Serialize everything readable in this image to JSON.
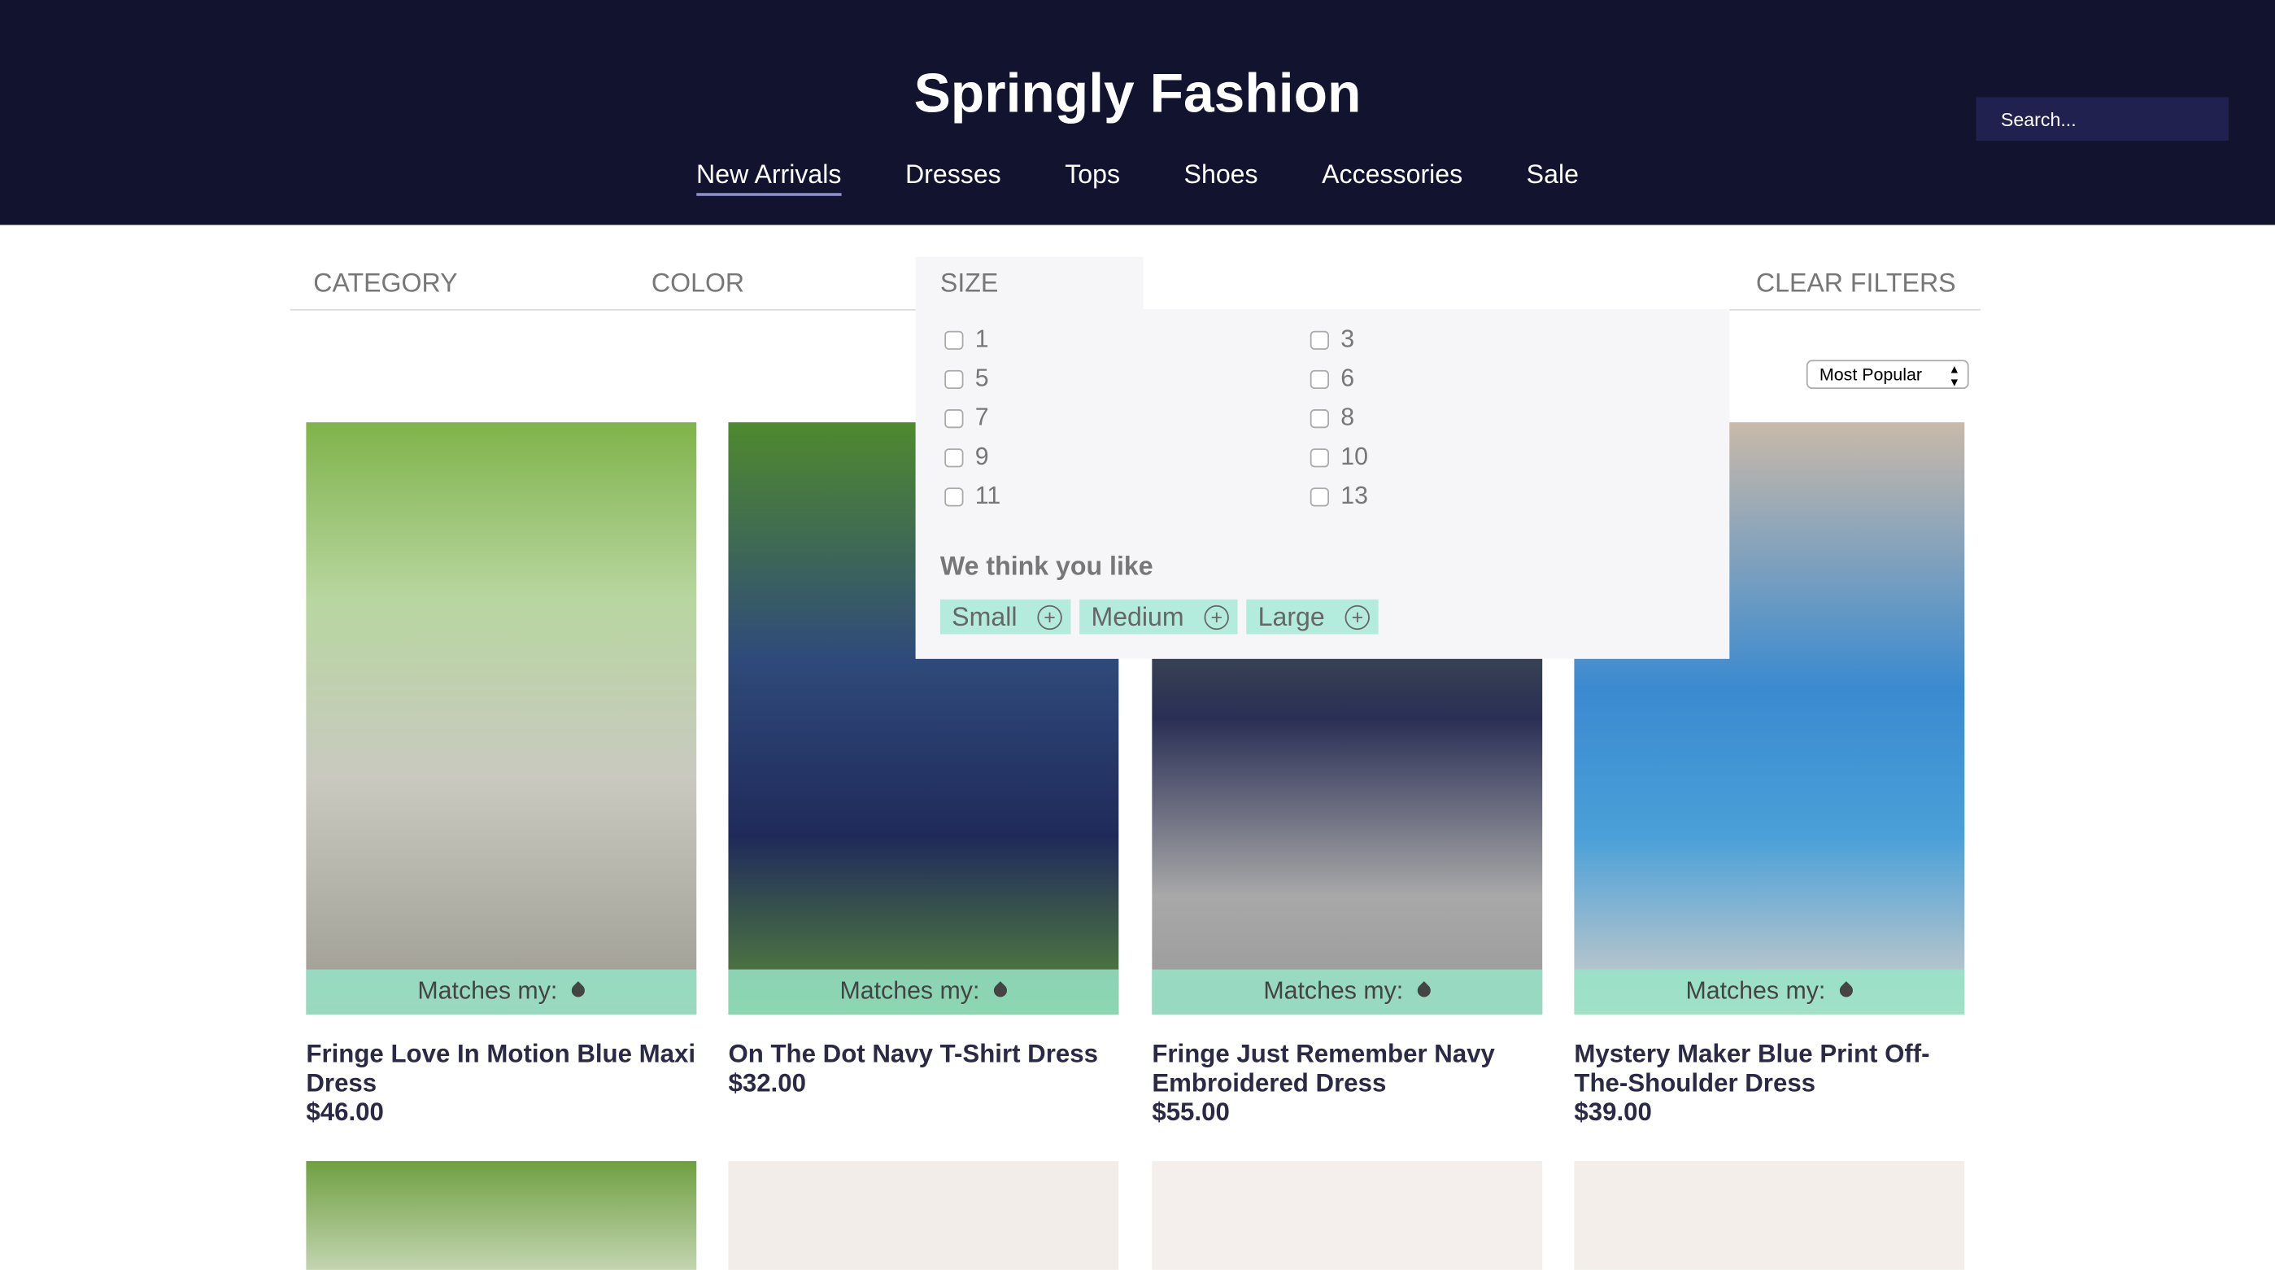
{
  "header": {
    "brand": "Springly Fashion",
    "search_placeholder": "Search...",
    "nav": [
      "New Arrivals",
      "Dresses",
      "Tops",
      "Shoes",
      "Accessories",
      "Sale"
    ],
    "active_nav": "New Arrivals"
  },
  "filters": {
    "category": "CATEGORY",
    "color": "COLOR",
    "size": "SIZE",
    "clear": "CLEAR FILTERS"
  },
  "size_panel": {
    "options_left": [
      "1",
      "5",
      "7",
      "9",
      "11"
    ],
    "options_right": [
      "3",
      "6",
      "8",
      "10",
      "13"
    ],
    "suggest_title": "We think you like",
    "suggestions": [
      "Small",
      "Medium",
      "Large"
    ]
  },
  "sort": {
    "selected": "Most Popular"
  },
  "products": [
    {
      "name": "Fringe Love In Motion Blue Maxi Dress",
      "price": "$46.00",
      "match": "Matches my:"
    },
    {
      "name": "On The Dot Navy T-Shirt Dress",
      "price": "$32.00",
      "match": "Matches my:"
    },
    {
      "name": "Fringe Just Remember Navy Embroidered Dress",
      "price": "$55.00",
      "match": "Matches my:"
    },
    {
      "name": "Mystery Maker Blue Print Off-The-Shoulder Dress",
      "price": "$39.00",
      "match": "Matches my:"
    }
  ],
  "colors": {
    "header_bg": "#12132f",
    "search_bg": "#20214f",
    "match_band": "#96e4c8",
    "chip": "#b3ecdc",
    "title_text": "#2a2a45"
  }
}
